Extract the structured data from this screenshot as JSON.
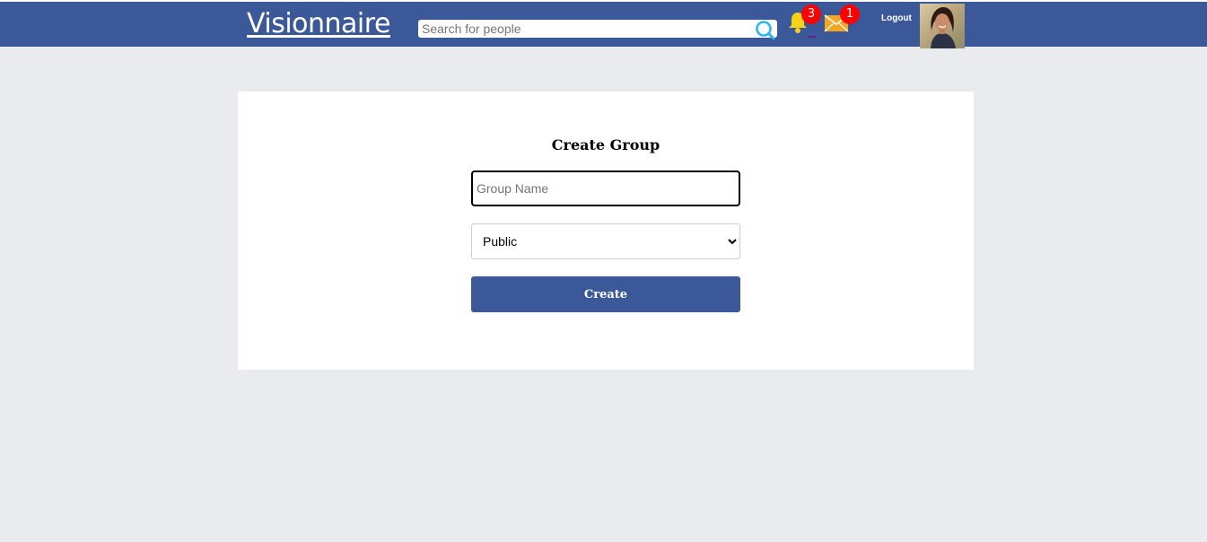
{
  "header": {
    "brand": "Visionnaire",
    "search_placeholder": "Search for people",
    "search_icon": "search-icon",
    "notifications": {
      "icon": "bell-icon",
      "count": "3"
    },
    "messages": {
      "icon": "mail-icon",
      "count": "1"
    },
    "logout_label": "Logout",
    "avatar": "user-avatar"
  },
  "form": {
    "title": "Create Group",
    "group_name_placeholder": "Group Name",
    "privacy_selected": "Public",
    "create_label": "Create"
  },
  "colors": {
    "navbar": "#3b5998",
    "page_background": "#e9ebee",
    "badge": "#ff0000",
    "bell": "#f6d21b",
    "mail": "#f5a623",
    "search_icon": "#29b6f6"
  }
}
